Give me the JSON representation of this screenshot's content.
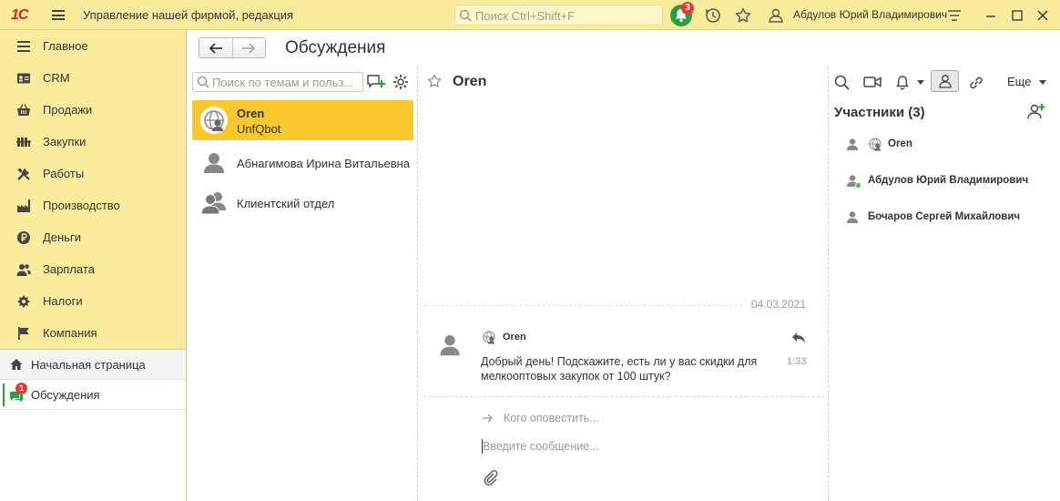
{
  "titlebar": {
    "logo": "1С",
    "app_title": "Управление нашей фирмой, редакция",
    "search_placeholder": "Поиск Ctrl+Shift+F",
    "notifications_count": "3",
    "user_name": "Абдулов Юрий Владимирович"
  },
  "sidebar": {
    "items": [
      {
        "label": "Главное",
        "icon": "menu-lines-icon"
      },
      {
        "label": "CRM",
        "icon": "contact-card-icon"
      },
      {
        "label": "Продажи",
        "icon": "basket-icon"
      },
      {
        "label": "Закупки",
        "icon": "truck-icon"
      },
      {
        "label": "Работы",
        "icon": "tools-icon"
      },
      {
        "label": "Производство",
        "icon": "factory-icon"
      },
      {
        "label": "Деньги",
        "icon": "ruble-coin-icon"
      },
      {
        "label": "Зарплата",
        "icon": "people-icon"
      },
      {
        "label": "Налоги",
        "icon": "emblem-icon"
      },
      {
        "label": "Компания",
        "icon": "flag-icon"
      }
    ],
    "home_label": "Начальная страница",
    "discussions_label": "Обсуждения",
    "discussions_badge": "1"
  },
  "main": {
    "title": "Обсуждения"
  },
  "threads": {
    "search_placeholder": "Поиск по темам и польз...",
    "items": [
      {
        "name": "Oren",
        "sub": "UnfQbot",
        "active": true
      },
      {
        "name": "Абнагимова Ирина Витальевна",
        "sub": "",
        "active": false
      },
      {
        "name": "Клиентский отдел",
        "sub": "",
        "active": false
      }
    ]
  },
  "chat": {
    "title": "Oren",
    "date": "04.03.2021",
    "message": {
      "author": "Oren",
      "text": "Добрый день! Подскажите, есть ли у вас скидки для мелкооптовых закупок от 100 штук?",
      "time": "1:33"
    },
    "notify_placeholder": "Кого оповестить...",
    "input_placeholder": "Введите сообщение..."
  },
  "right": {
    "more_label": "Еще",
    "participants_title": "Участники (3)",
    "participants": [
      {
        "name": "Oren",
        "bot": true
      },
      {
        "name": "Абдулов Юрий Владимирович",
        "bot": false,
        "online": true
      },
      {
        "name": "Бочаров Сергей Михайлович",
        "bot": false
      }
    ]
  },
  "colors": {
    "panel_yellow": "#fbec9d",
    "active_yellow": "#f8c82e",
    "accent_green": "#27a145",
    "badge_red": "#e53935"
  }
}
